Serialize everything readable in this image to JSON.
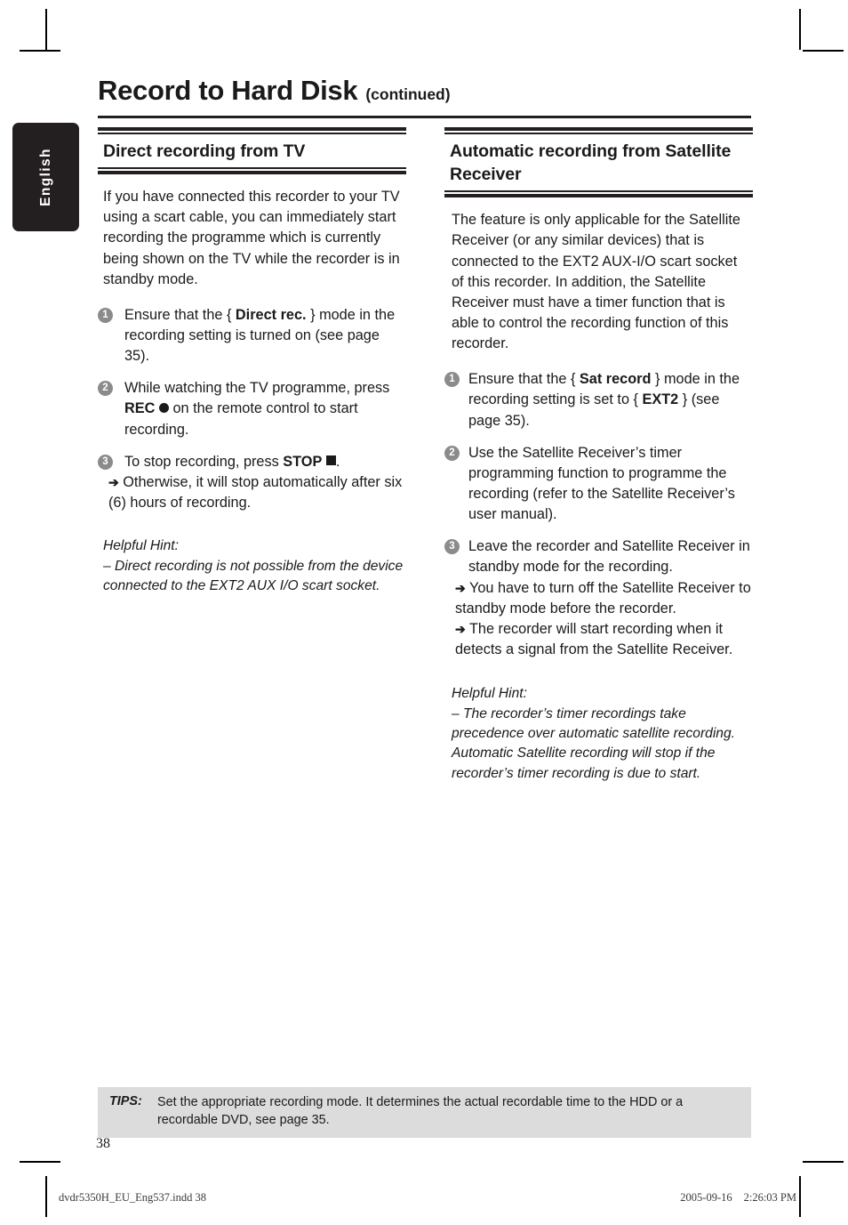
{
  "language_tab": {
    "label": "English"
  },
  "header": {
    "title": "Record to Hard Disk",
    "continued": "(continued)"
  },
  "columns": {
    "left": {
      "section_title": "Direct recording from TV",
      "intro": "If you have connected this recorder to your TV using a scart cable, you can immediately start recording the programme which is currently being shown on the TV while the recorder is in standby mode.",
      "steps": [
        {
          "num": "1",
          "pre": "Ensure that the { ",
          "bold": "Direct rec.",
          "post": " } mode in the recording setting is turned on (see page 35)."
        },
        {
          "num": "2",
          "pre": "While watching the TV programme, press ",
          "bold": "REC",
          "post": " on the remote control to start recording.",
          "glyph": "record-dot"
        },
        {
          "num": "3",
          "pre": "To stop recording, press ",
          "bold": "STOP",
          "post": ".",
          "glyph": "stop-square",
          "arrow": "Otherwise, it will stop automatically after six (6) hours of recording."
        }
      ],
      "hint": {
        "title": "Helpful Hint:",
        "text": "– Direct recording is not possible from the device connected to the EXT2 AUX I/O scart socket."
      }
    },
    "right": {
      "section_title": "Automatic recording from Satellite Receiver",
      "intro": "The feature is only applicable for the Satellite Receiver (or any similar devices) that is connected to the EXT2 AUX-I/O scart socket of this recorder. In addition, the Satellite Receiver must have a timer function that is able to control the recording function of this recorder.",
      "steps": [
        {
          "num": "1",
          "pre": "Ensure that the { ",
          "bold": "Sat record",
          "mid": " } mode in the recording setting is set to { ",
          "bold2": "EXT2",
          "post": " } (see page 35)."
        },
        {
          "num": "2",
          "pre": "Use the Satellite Receiver’s timer programming function to programme the recording (refer to the Satellite Receiver’s user manual)."
        },
        {
          "num": "3",
          "pre": "Leave the recorder and Satellite Receiver in standby mode for the recording.",
          "arrow": "You have to turn off the Satellite Receiver to standby mode before the recorder.",
          "arrow2": "The recorder will start recording when it detects a signal from the Satellite Receiver."
        }
      ],
      "hint": {
        "title": "Helpful Hint:",
        "text": "– The recorder’s timer recordings take precedence over automatic satellite recording. Automatic Satellite recording will stop if the recorder’s timer recording is due to start."
      }
    }
  },
  "tips": {
    "label": "TIPS:",
    "text": "Set the appropriate recording mode. It determines the actual recordable time to the HDD or a recordable DVD, see page 35."
  },
  "page_number": "38",
  "footer": {
    "file": "dvdr5350H_EU_Eng537.indd   38",
    "date": "2005-09-16",
    "time": "2:26:03 PM"
  },
  "arrow_glyph": "➔",
  "colors": {
    "ink": "#1a1a1a",
    "rule": "#231f20",
    "bullet": "#8b8b8b",
    "tips_bg": "#dcdcdc",
    "tab_bg": "#231f20"
  }
}
